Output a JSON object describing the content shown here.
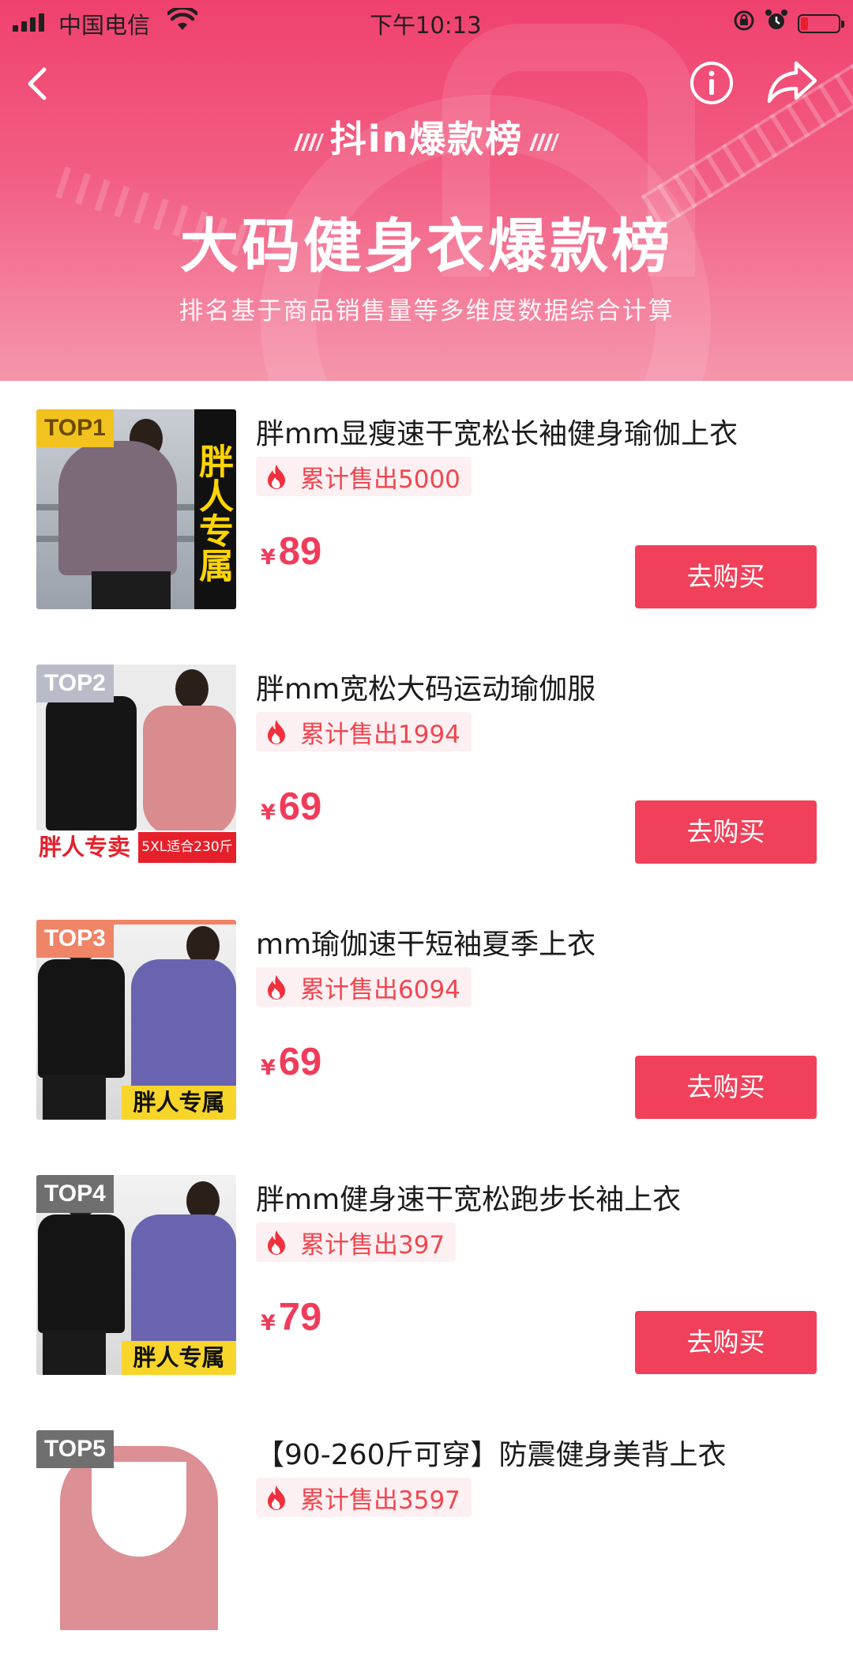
{
  "status_bar": {
    "carrier": "中国电信",
    "time": "下午10:13",
    "battery_level": 0.2
  },
  "header": {
    "brand": "抖in爆款榜",
    "title": "大码健身衣爆款榜",
    "subtitle": "排名基于商品销售量等多维度数据综合计算",
    "icons": [
      "chevron-left-icon",
      "info-icon",
      "share-icon"
    ]
  },
  "products": [
    {
      "rank": "TOP1",
      "name": "胖mm显瘦速干宽松长袖健身瑜伽上衣",
      "sales": "累计售出5000",
      "currency": "¥",
      "price": "89",
      "buy": "去购买",
      "image_tag": "胖人专属",
      "rank_color": "#f2c21f"
    },
    {
      "rank": "TOP2",
      "name": "胖mm宽松大码运动瑜伽服",
      "sales": "累计售出1994",
      "currency": "¥",
      "price": "69",
      "buy": "去购买",
      "image_tag": "胖人专卖",
      "image_tag2": "5XL适合230斤",
      "rank_color": "#b9bcc8"
    },
    {
      "rank": "TOP3",
      "name": "mm瑜伽速干短袖夏季上衣",
      "sales": "累计售出6094",
      "currency": "¥",
      "price": "69",
      "buy": "去购买",
      "image_tag": "胖人专属",
      "rank_color": "#ef8466"
    },
    {
      "rank": "TOP4",
      "name": "胖mm健身速干宽松跑步长袖上衣",
      "sales": "累计售出397",
      "currency": "¥",
      "price": "79",
      "buy": "去购买",
      "image_tag": "胖人专属",
      "rank_color": "#6f6f6f"
    },
    {
      "rank": "TOP5",
      "name": "【90-260斤可穿】防震健身美背上衣",
      "sales": "累计售出3597",
      "rank_color": "#6f6f6f"
    }
  ]
}
